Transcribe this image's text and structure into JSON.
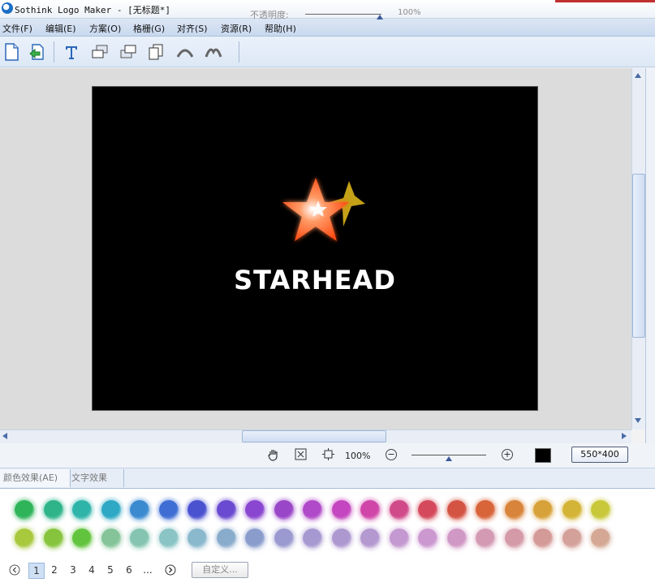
{
  "window": {
    "title": "Sothink Logo Maker - [无标题*]"
  },
  "menu": [
    {
      "label": "文件(F)"
    },
    {
      "label": "编辑(E)"
    },
    {
      "label": "方案(O)"
    },
    {
      "label": "格栅(G)"
    },
    {
      "label": "对齐(S)"
    },
    {
      "label": "资源(R)"
    },
    {
      "label": "帮助(H)"
    }
  ],
  "toolbar": {
    "icons": [
      "new-file-icon",
      "open-file-icon",
      "text-tool-icon",
      "bring-forward-icon",
      "send-backward-icon",
      "duplicate-icon",
      "rotate-left-icon",
      "rotate-right-icon"
    ],
    "opacity_label": "不透明度:",
    "opacity_value": "100%",
    "opacity_level": 1.0
  },
  "canvas": {
    "background": "#000000",
    "logo_text": "STARHEAD",
    "star_primary_color": "#ff5a1a",
    "star_secondary_color": "#e8c21a"
  },
  "zoombar": {
    "zoom_value": "100%",
    "zoom_out": "−",
    "zoom_in": "+",
    "size_label": "550*400",
    "swatch_color": "#000000"
  },
  "tabs": [
    {
      "label": "颜色效果(AE)",
      "active": true
    },
    {
      "label": "文字效果",
      "active": false
    }
  ],
  "effects": {
    "row1": [
      "#2fb45a",
      "#2fb48a",
      "#2fb4aa",
      "#2ea8c4",
      "#3a8ad0",
      "#3e6ed4",
      "#4a52d0",
      "#6a4ad0",
      "#8a46d0",
      "#9a46c8",
      "#b04ac8",
      "#c446c0",
      "#d046a8",
      "#d04a8a",
      "#d44a5c",
      "#d45444",
      "#d8643a",
      "#d8843a",
      "#d8a23a",
      "#d4b436",
      "#c8c83a"
    ],
    "row2": [
      "#a8c83e",
      "#86c43e",
      "#62c43e",
      "#84c498",
      "#84c4b0",
      "#8ac4c4",
      "#8ab8cc",
      "#8aaccc",
      "#8a9ccc",
      "#9a9ad0",
      "#a698d0",
      "#ae98d0",
      "#b498d0",
      "#c498d0",
      "#cc98d0",
      "#d098c4",
      "#d49ab4",
      "#d49aa8",
      "#d49a98",
      "#d4a09a",
      "#d4a894"
    ],
    "pages": [
      "1",
      "2",
      "3",
      "4",
      "5",
      "6",
      "..."
    ],
    "current_page": "1",
    "custom_label": "自定义..."
  }
}
